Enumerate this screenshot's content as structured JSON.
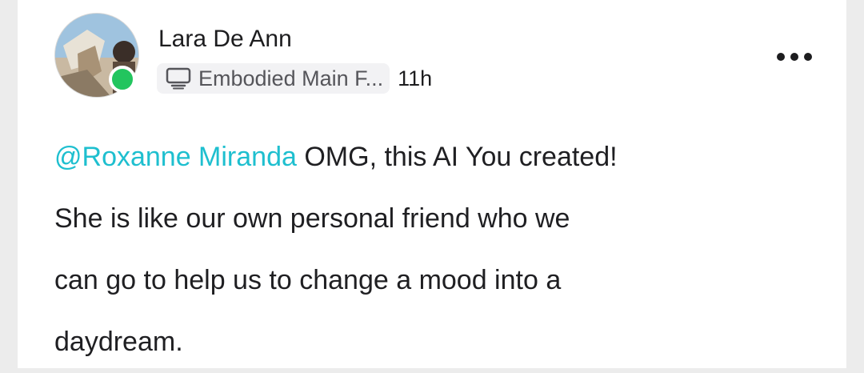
{
  "post": {
    "author_name": "Lara De Ann",
    "space_name": "Embodied Main F...",
    "time_ago": "11h",
    "mention": "@Roxanne Miranda",
    "lines": [
      " OMG, this AI You created!",
      "She is like our own personal friend who we",
      "can go to help us to change a mood into a",
      "daydream."
    ]
  },
  "icons": {
    "space_icon": "monitor-icon",
    "more_icon": "more-horizontal-icon",
    "presence": "online-status-dot"
  },
  "colors": {
    "mention": "#1ebfcf",
    "online": "#22c55e",
    "text": "#1f1f22",
    "muted": "#55555a"
  }
}
